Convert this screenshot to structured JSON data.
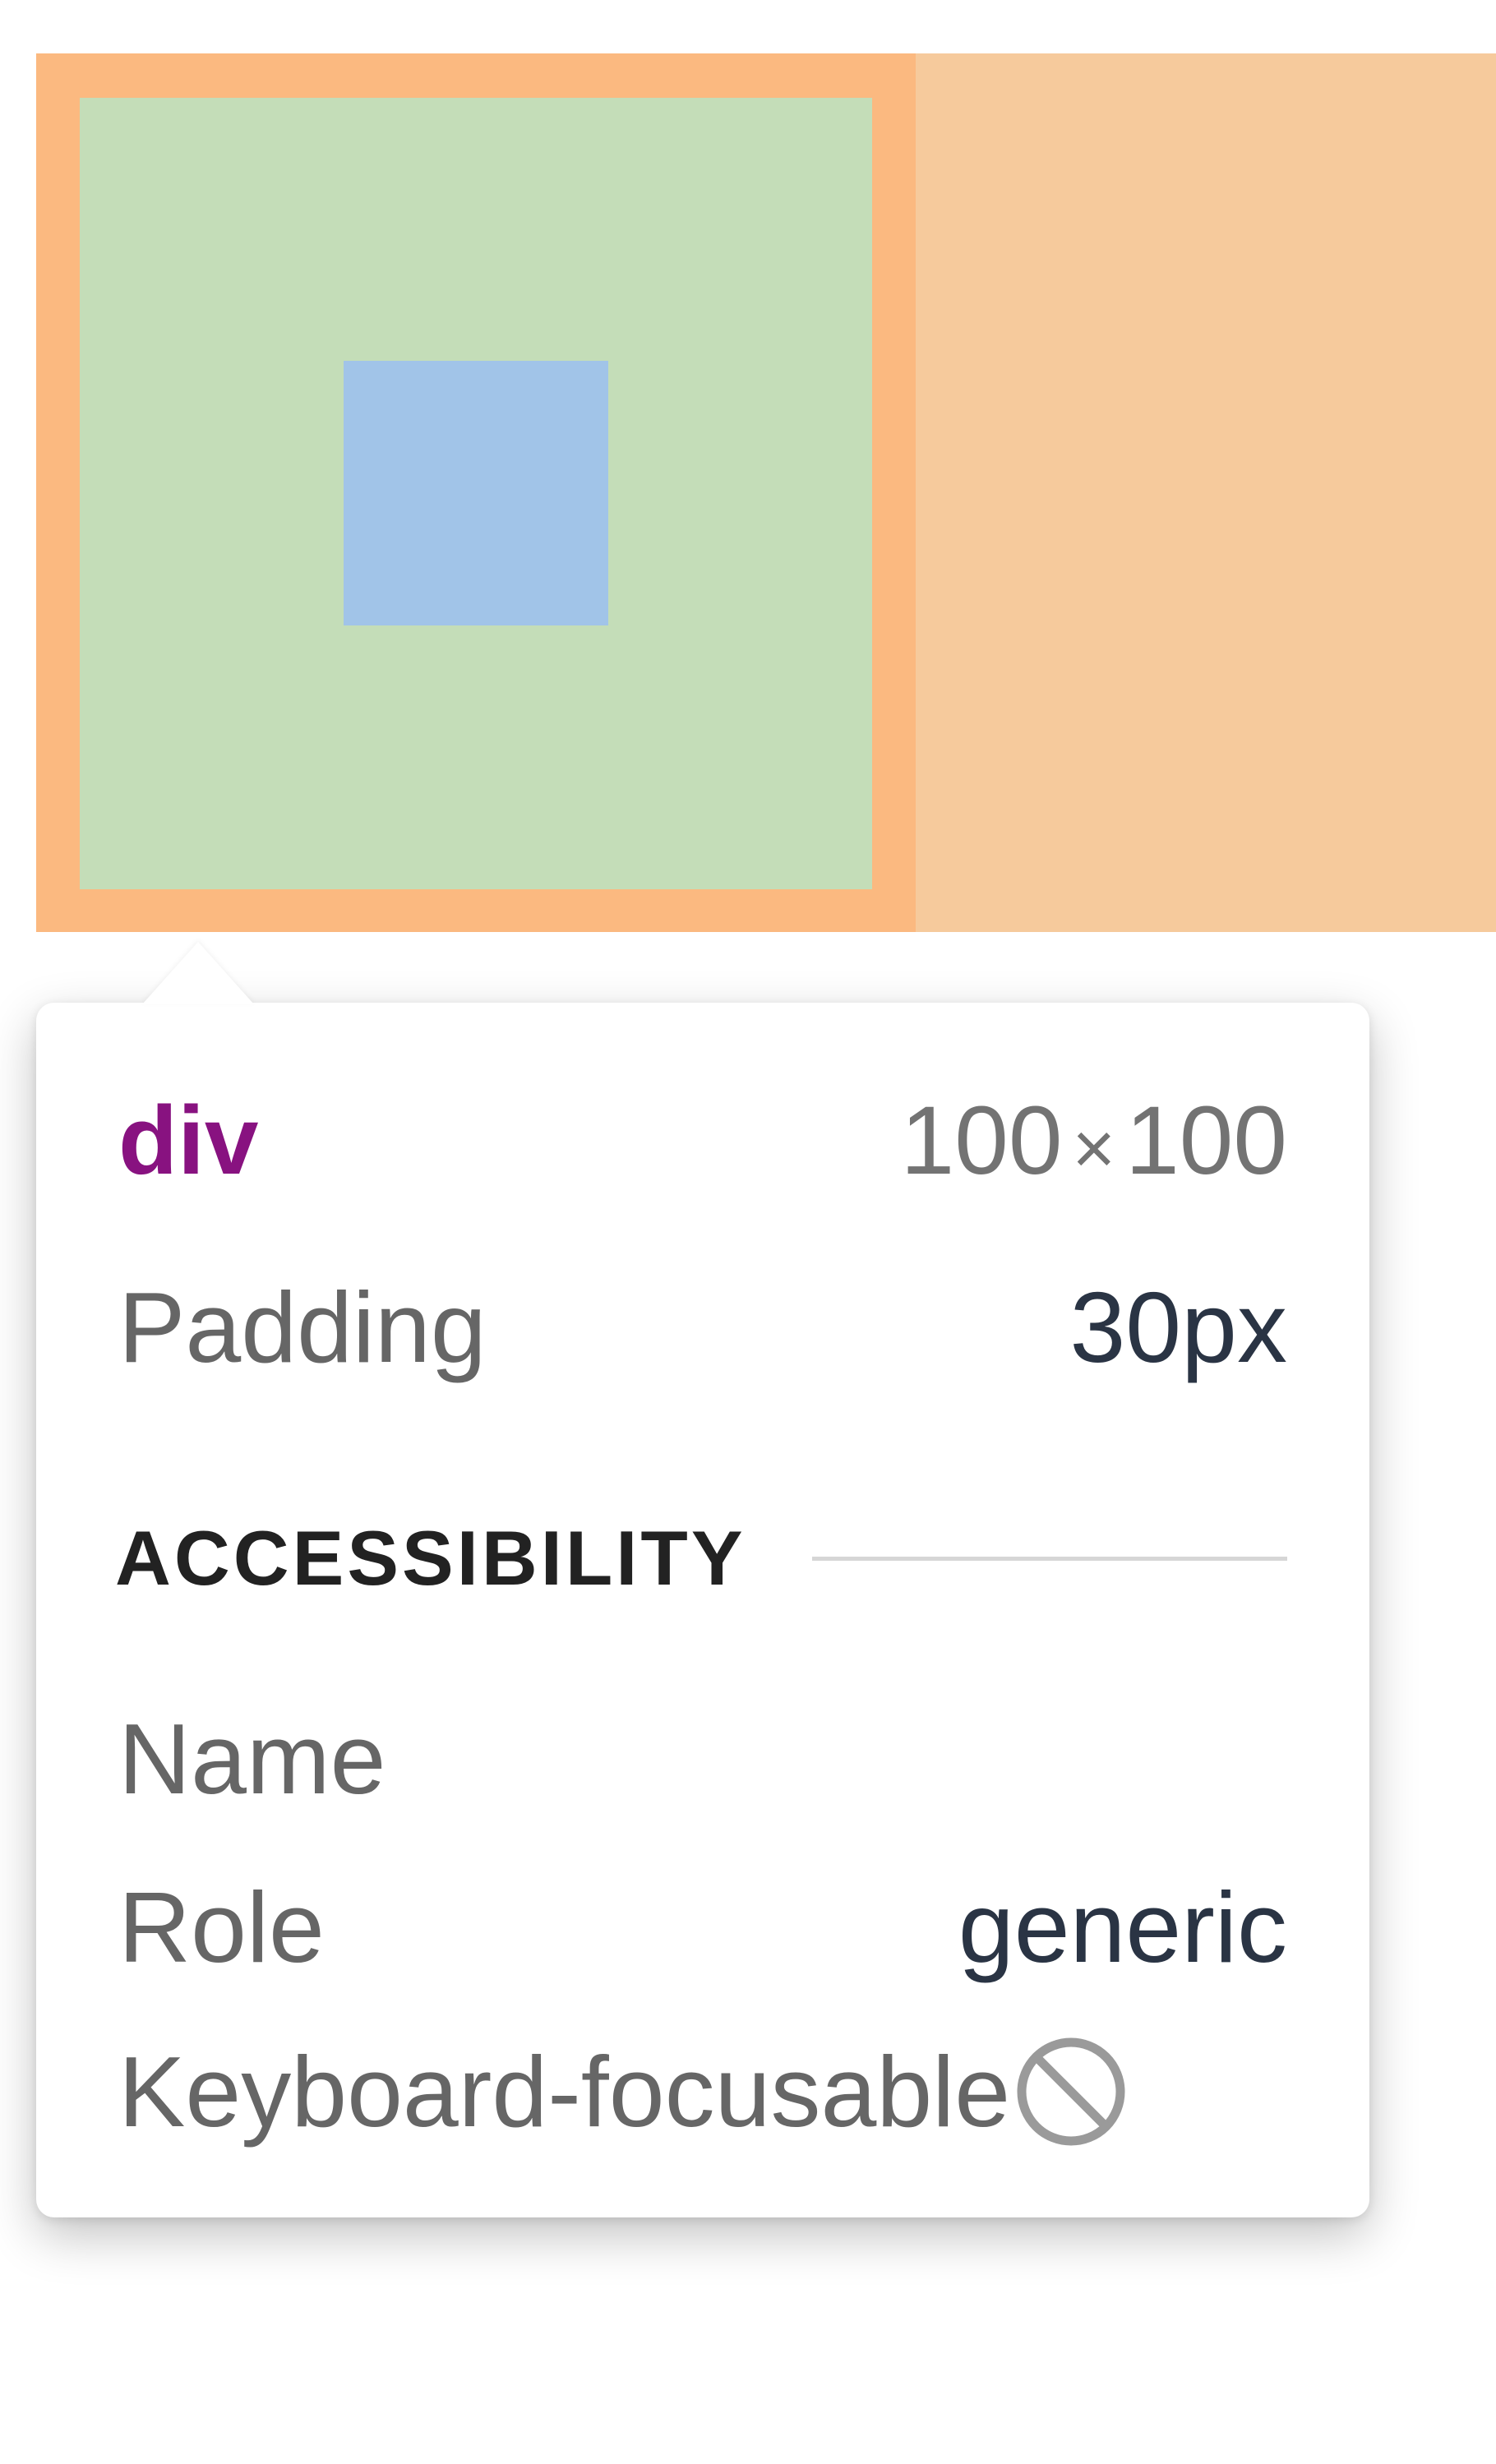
{
  "tooltip": {
    "element_tag": "div",
    "dimensions": {
      "width": "100",
      "separator": "×",
      "height": "100"
    },
    "padding": {
      "label": "Padding",
      "value": "30px"
    },
    "accessibility": {
      "title": "ACCESSIBILITY",
      "name_label": "Name",
      "name_value": "",
      "role_label": "Role",
      "role_value": "generic",
      "keyboard_label": "Keyboard-focusable",
      "keyboard_icon": "not-allowed-icon"
    }
  },
  "highlight_colors": {
    "margin": "#f6ca9c",
    "border": "#fbb980",
    "padding": "#c4ddb8",
    "content": "#a1c4e8"
  }
}
